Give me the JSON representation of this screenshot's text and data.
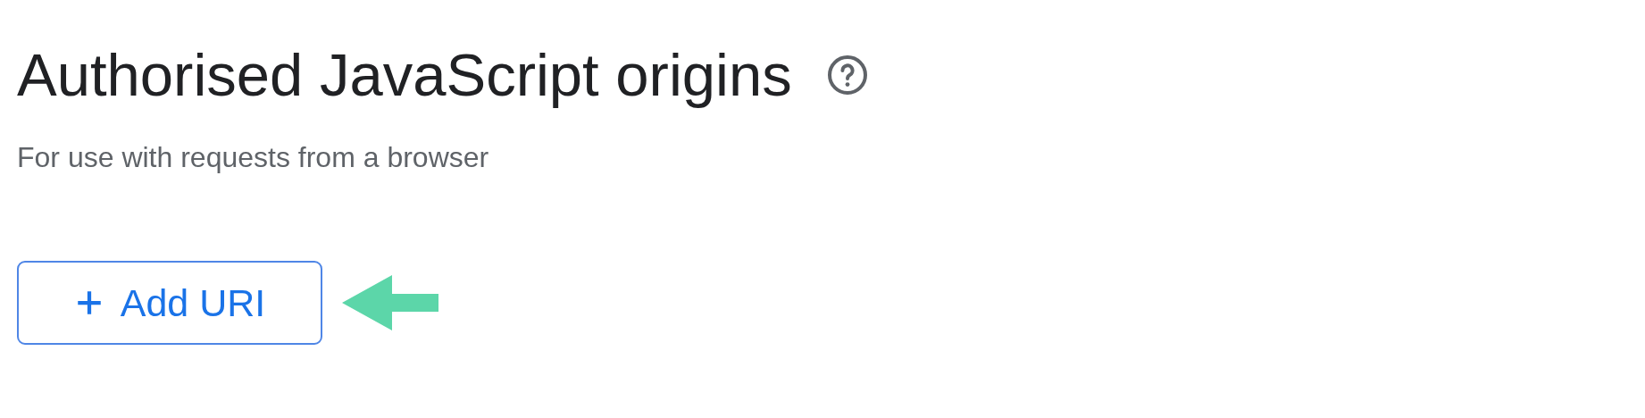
{
  "section": {
    "title": "Authorised JavaScript origins",
    "subtitle": "For use with requests from a browser"
  },
  "add_button": {
    "label": "Add URI"
  }
}
